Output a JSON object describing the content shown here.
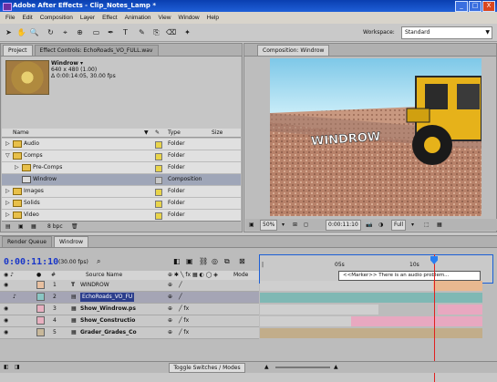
{
  "window": {
    "title": "Adobe After Effects - Clip_Notes_Lamp *",
    "min": "_",
    "max": "□",
    "close": "X"
  },
  "menu": [
    "File",
    "Edit",
    "Composition",
    "Layer",
    "Effect",
    "Animation",
    "View",
    "Window",
    "Help"
  ],
  "toolbar": {
    "tools": [
      "selection-tool",
      "hand-tool",
      "zoom-tool",
      "rotate-tool",
      "camera-tool",
      "pan-behind-tool",
      "rectangle-tool",
      "pen-tool",
      "text-tool",
      "brush-tool",
      "clone-tool",
      "eraser-tool",
      "puppet-tool"
    ],
    "workspace_label": "Workspace:",
    "workspace_value": "Standard"
  },
  "project": {
    "tabs": [
      "Project",
      "Effect Controls: EchoRoads_VO_FULL.wav"
    ],
    "selected_name": "Windrow ▾",
    "info_line1": "640 x 480 (1.00)",
    "info_line2": "Δ 0:00:14:05, 30.00 fps",
    "columns": {
      "name": "Name",
      "type": "Type",
      "size": "Size"
    },
    "items": [
      {
        "name": "Audio",
        "type": "Folder",
        "indent": 0,
        "kind": "folder"
      },
      {
        "name": "Comps",
        "type": "Folder",
        "indent": 0,
        "kind": "folder"
      },
      {
        "name": "Pre-Comps",
        "type": "Folder",
        "indent": 1,
        "kind": "folder"
      },
      {
        "name": "Windrow",
        "type": "Composition",
        "indent": 1,
        "kind": "comp",
        "selected": true
      },
      {
        "name": "Images",
        "type": "Folder",
        "indent": 0,
        "kind": "folder"
      },
      {
        "name": "Solids",
        "type": "Folder",
        "indent": 0,
        "kind": "folder"
      },
      {
        "name": "Video",
        "type": "Folder",
        "indent": 0,
        "kind": "folder"
      }
    ],
    "bpc": "8 bpc"
  },
  "composition": {
    "tab": "Composition: Windrow",
    "overlay_text": "WINDROW",
    "zoom": "50%",
    "timecode": "0:00:11:10",
    "resolution": "Full"
  },
  "timeline": {
    "tabs": [
      "Render Queue",
      "Windrow"
    ],
    "timecode": "0:00:11:10",
    "fps": "(30.00 fps)",
    "ruler_ticks": [
      "05s",
      "10s"
    ],
    "marker_text": "<<Marker>> There is an audio problem...",
    "col_source": "Source Name",
    "col_mode": "Mode",
    "layers": [
      {
        "num": "1",
        "name": "WINDROW",
        "label_color": "#e8c0a0",
        "icon": "T"
      },
      {
        "num": "2",
        "name": "EchoRoads_VO_FU",
        "label_color": "#8ac6c4",
        "icon": "audio",
        "selected": true
      },
      {
        "num": "3",
        "name": "Show_Windrow.ps",
        "label_color": "#e8b0c0",
        "icon": "image"
      },
      {
        "num": "4",
        "name": "Show_Constructio",
        "label_color": "#e8b0c0",
        "icon": "image"
      },
      {
        "num": "5",
        "name": "Grader_Grades_Co",
        "label_color": "#c8b89a",
        "icon": "image"
      }
    ],
    "toggle_label": "Toggle Switches / Modes"
  },
  "colors": {
    "accent": "#1c5fd6",
    "cti": "#e02020"
  }
}
